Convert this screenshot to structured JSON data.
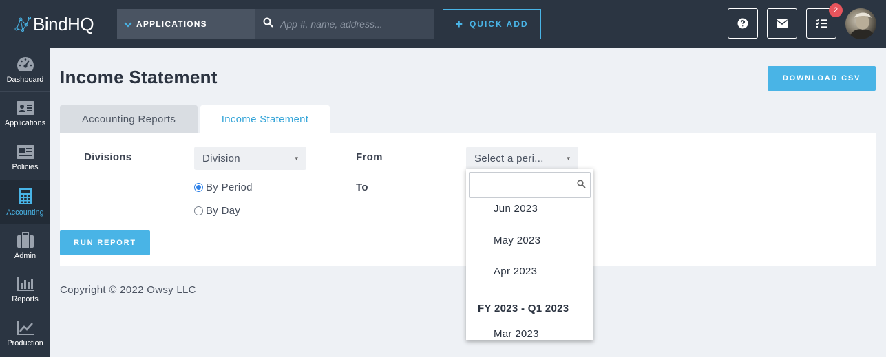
{
  "header": {
    "logo_text": "BindHQ",
    "applications_label": "APPLICATIONS",
    "search_placeholder": "App #, name, address...",
    "quick_add_label": "QUICK ADD",
    "tasks_badge_count": "2",
    "accent_color": "#49b4e6",
    "bar_color": "#2b3542"
  },
  "sidebar": {
    "items": [
      {
        "label": "Dashboard",
        "icon": "gauge-icon"
      },
      {
        "label": "Applications",
        "icon": "id-card-icon"
      },
      {
        "label": "Policies",
        "icon": "policy-card-icon"
      },
      {
        "label": "Accounting",
        "icon": "calculator-icon",
        "active": true
      },
      {
        "label": "Admin",
        "icon": "briefcase-icon"
      },
      {
        "label": "Reports",
        "icon": "bar-chart-icon"
      },
      {
        "label": "Production",
        "icon": "line-chart-icon"
      }
    ]
  },
  "main": {
    "title": "Income Statement",
    "download_label": "DOWNLOAD CSV",
    "tabs": [
      {
        "label": "Accounting Reports",
        "active": false
      },
      {
        "label": "Income Statement",
        "active": true
      }
    ],
    "form": {
      "divisions_label": "Divisions",
      "division_value": "Division",
      "by_period_label": "By Period",
      "by_day_label": "By Day",
      "period_mode": "By Period",
      "from_label": "From",
      "to_label": "To",
      "from_value": "Select a peri...",
      "run_label": "RUN REPORT"
    },
    "period_dropdown": {
      "search_value": "",
      "options": [
        "Jun 2023",
        "May 2023",
        "Apr 2023"
      ],
      "group_label": "FY 2023 - Q1 2023",
      "group_options": [
        "Mar 2023"
      ]
    }
  },
  "footer": {
    "copyright": "Copyright © 2022 Owsy LLC"
  }
}
